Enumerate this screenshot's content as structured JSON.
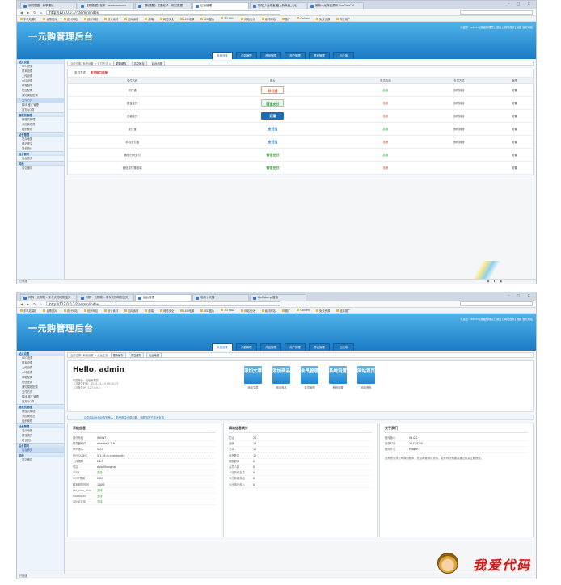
{
  "browser1": {
    "tabs": [
      "测试视图 - 分享理论",
      "【新提醒】在本 - www.wmodu...",
      "【新提醒】发表帖子 - 网友数据...",
      "后台管理",
      "网站_1元夺宝,爱上新商品_1元...",
      "最新一元夺宝源码 YunGouCM..."
    ],
    "url": "http://127.0.0.1/?/admin/index",
    "bookmarks": [
      "手机站模板",
      "谷歌图片",
      "设计网站",
      "设计网站",
      "设计素材",
      "图片素材",
      "前端",
      "网络安全",
      "LED电源",
      "LED图片",
      "3D MAX",
      "网站优化",
      "素材网站",
      "推广",
      "Golden",
      "免费资源",
      "淘宝用户"
    ]
  },
  "browser2": {
    "tabs": [
      "闪购一元购物 - 中今天的网购宝贝",
      "闪购一元购物 - 中今天的网购宝贝",
      "后台管理",
      "电商 | 天猫",
      "kjellsberg 搜索"
    ],
    "url": "http://127.0.0.1/?/admin/index",
    "bookmarks": [
      "手机站模板",
      "谷歌图片",
      "设计网站",
      "设计网站",
      "设计素材",
      "图片素材",
      "前端",
      "网络安全",
      "LED电源",
      "LED图片",
      "3D MAX",
      "网站优化",
      "素材网站",
      "推广",
      "Golden",
      "免费资源",
      "链接推广"
    ]
  },
  "app": {
    "logo": "一元购管理后台",
    "userline": "欢迎您：admin [超级管理员] [退出] [网站首页] 地图 官方网站",
    "menu": [
      "系统设置",
      "内容管理",
      "商品管理",
      "用户管理",
      "界面管理",
      "云应用"
    ],
    "sidebar": [
      {
        "head": "站点设置",
        "items": [
          "SEO设置",
          "基本设置",
          "上传设置",
          "水印设置",
          "邮箱配置",
          "短信配置",
          "通知模板配置",
          "支付方式",
          "模块 推广管理",
          "官方QQ群"
        ]
      },
      {
        "head": "管理员管理",
        "items": [
          "管理员管理",
          "添加管理员",
          "组织管理"
        ]
      },
      {
        "head": "站长管理",
        "items": [
          "站点地图",
          "网站提交",
          "站长统计"
        ]
      },
      {
        "head": "后台首页",
        "items": [
          "后台首页"
        ]
      },
      {
        "head": "其他",
        "items": [
          "清空缓存"
        ]
      }
    ],
    "quick_buttons": [
      "更新缓存",
      "清空缓存",
      "后台地图"
    ]
  },
  "page1": {
    "crumb": "当前位置: 系统设置 > 支付方式 >",
    "subtabs": [
      "支付方式",
      "支付接口选择"
    ],
    "columns": [
      "支付名称",
      "图片",
      "是否启用",
      "支付方式",
      "管理"
    ],
    "rows": [
      {
        "name": "财付通",
        "logo": "财付通",
        "state": "启用",
        "type": "即时到帐",
        "op": "设置"
      },
      {
        "name": "国宝支付",
        "logo": "国宝支付",
        "state": "关闭",
        "type": "即时到帐",
        "op": "设置"
      },
      {
        "name": "汇潮支付",
        "logo": "汇潮",
        "state": "关闭",
        "type": "即时到帐",
        "op": "设置"
      },
      {
        "name": "支付宝",
        "logo": "支付宝",
        "state": "启用",
        "type": "即时到帐",
        "op": "设置"
      },
      {
        "name": "手机支付宝",
        "logo": "支付宝",
        "state": "关闭",
        "type": "即时到帐",
        "op": "设置"
      },
      {
        "name": "微信扫码支付",
        "logo": "微信支付",
        "state": "启用",
        "type": "",
        "op": "设置"
      },
      {
        "name": "微信支付微信端",
        "logo": "微信支付",
        "state": "关闭",
        "type": "",
        "op": "设置"
      }
    ]
  },
  "page2": {
    "crumb": "当前位置: 系统设置 > 后台主页",
    "hello": "Hello, admin",
    "info": [
      "所属角色：超级管理员",
      "上次登录时间：2015-11-19 09:10:33",
      "上次登录IP：127.0.0.1"
    ],
    "quick": [
      {
        "t": "添加文章",
        "cap": "添加文章"
      },
      {
        "t": "添加商品",
        "cap": "添加商品"
      },
      {
        "t": "会员管理",
        "cap": "会员管理"
      },
      {
        "t": "系统设置",
        "cap": "系统设置"
      },
      {
        "t": "网站首页",
        "cap": "网站首页"
      }
    ],
    "notice": "请勿将后台地址告知他人，若使用中出现问题，请联系官方技术支持",
    "sys_title": "系统信息",
    "sys": [
      {
        "k": "操作系统",
        "v": "WINNT"
      },
      {
        "k": "服务器软件",
        "v": "Apache/2.2.9"
      },
      {
        "k": "PHP版本",
        "v": "5.2.6"
      },
      {
        "k": "MYSQL版本",
        "v": "5.1.28-rc-community"
      },
      {
        "k": "上传限制",
        "v": "20M"
      },
      {
        "k": "时区",
        "v": "Asia/Shanghai"
      },
      {
        "k": "GD库",
        "v": "支持"
      },
      {
        "k": "POST限制",
        "v": "20M"
      },
      {
        "k": "脚本超时时间",
        "v": "100秒"
      },
      {
        "k": "set_time_limit",
        "v": "支持"
      },
      {
        "k": "fsockopen",
        "v": "支持"
      },
      {
        "k": "ZEND支持",
        "v": "支持"
      }
    ],
    "stat_title": "网站信息统计",
    "stat": [
      {
        "k": "栏目",
        "v": "21"
      },
      {
        "k": "品牌",
        "v": "14"
      },
      {
        "k": "文章",
        "v": "12"
      },
      {
        "k": "商品数量",
        "v": "12"
      },
      {
        "k": "期数数量",
        "v": "0"
      },
      {
        "k": "会员人数",
        "v": "0"
      },
      {
        "k": "今日新增会员",
        "v": "0"
      },
      {
        "k": "今日新增商品",
        "v": "0"
      },
      {
        "k": "今日用户收入",
        "v": "0"
      }
    ],
    "about_title": "关于我们",
    "about": [
      {
        "k": "程序版本",
        "v": "V4.0.2"
      },
      {
        "k": "最新时间",
        "v": "2015/7/25"
      },
      {
        "k": "程序开发",
        "v": "Progen"
      }
    ],
    "about_text": "此系统为非公司原创程序，售后和使用请谨慎，若有商业需要请通过购买正版授权。"
  },
  "status1": "已就绪",
  "status2": "已就绪",
  "watermark": "我爱代码",
  "colors": {
    "header": "#1a7bc4",
    "accent": "#d42020",
    "enabled": "#2a9d2a",
    "disabled": "#d62424"
  }
}
